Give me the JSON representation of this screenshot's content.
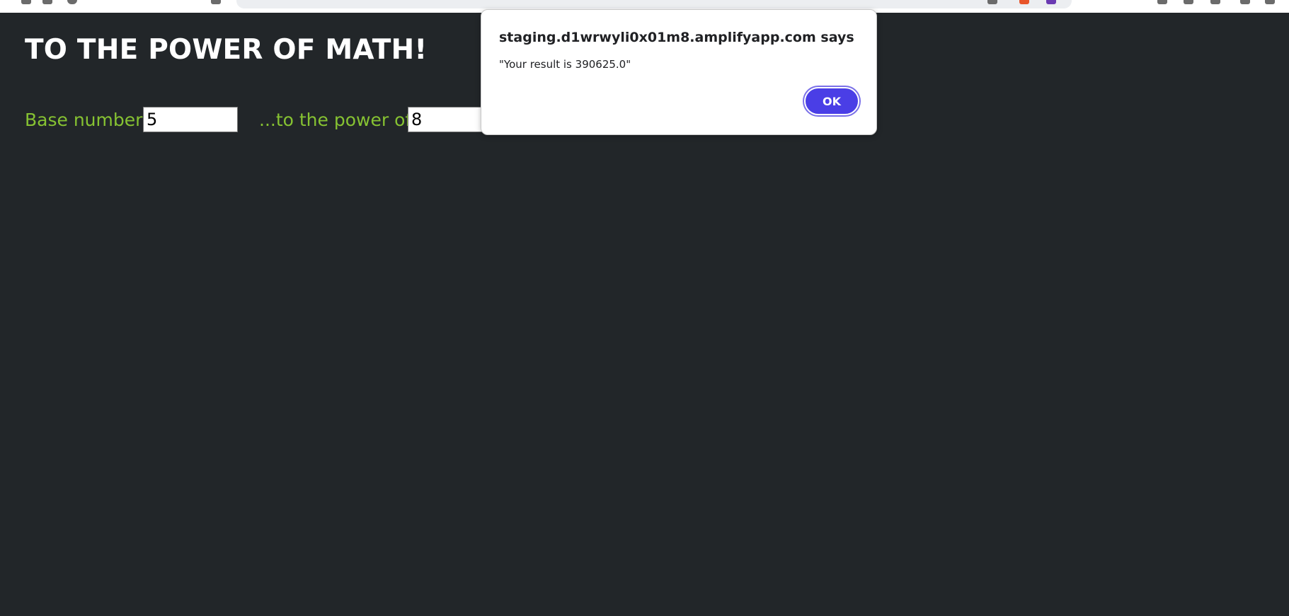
{
  "page": {
    "title": "TO THE POWER OF MATH!",
    "base_label": "Base number:",
    "base_value": "5",
    "power_label": "...to the power of:",
    "power_value": "8"
  },
  "dialog": {
    "origin": "staging.d1wrwyli0x01m8.amplifyapp.com says",
    "message": "\"Your result is 390625.0\"",
    "ok_label": "OK"
  },
  "colors": {
    "background": "#222629",
    "label_green": "#86c232",
    "title_white": "#ffffff",
    "ok_button": "#4a3ee6"
  }
}
